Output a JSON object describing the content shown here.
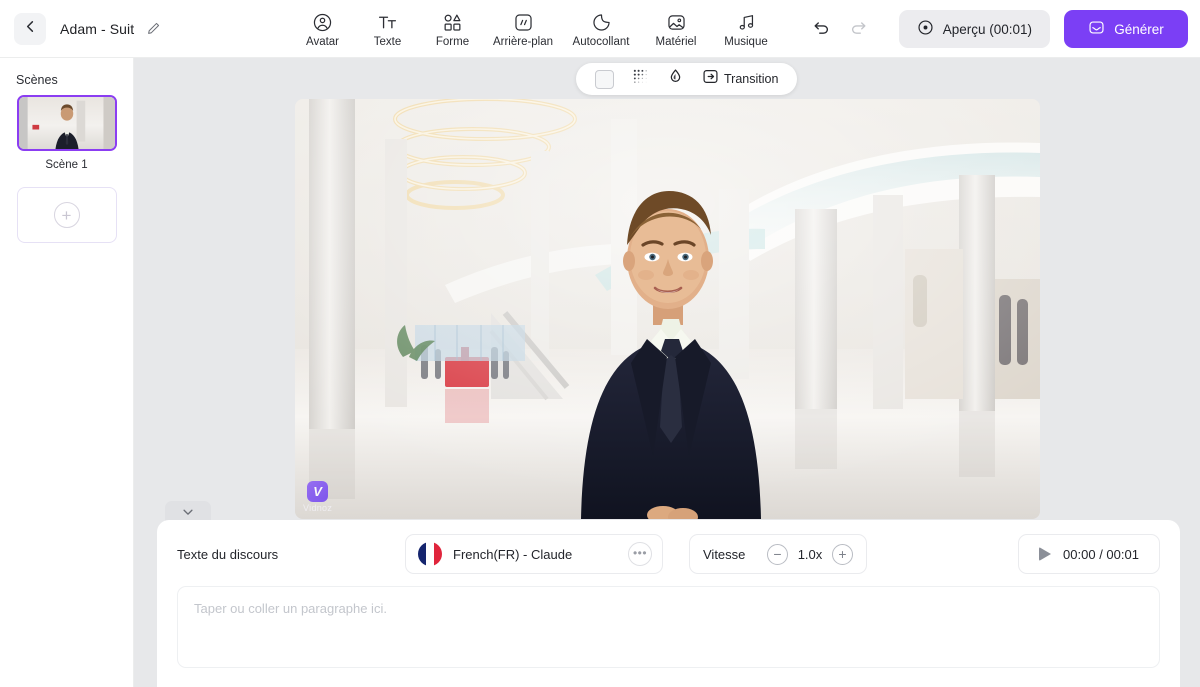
{
  "header": {
    "back_icon": "chevron-left-icon",
    "project_title": "Adam - Suit",
    "edit_icon": "pencil-edit-icon",
    "tools": [
      {
        "label": "Avatar",
        "icon": "avatar-person-circle-icon"
      },
      {
        "label": "Texte",
        "icon": "text-tt-icon"
      },
      {
        "label": "Forme",
        "icon": "shapes-grid-icon"
      },
      {
        "label": "Arrière-plan",
        "icon": "background-square-slash-icon"
      },
      {
        "label": "Autocollant",
        "icon": "sticker-circle-icon"
      },
      {
        "label": "Matériel",
        "icon": "image-media-icon"
      },
      {
        "label": "Musique",
        "icon": "music-notes-icon"
      }
    ],
    "undo": {
      "icon": "undo-arrow-icon",
      "enabled": true
    },
    "redo": {
      "icon": "redo-arrow-icon",
      "enabled": false
    },
    "preview_button": {
      "label": "Aperçu (00:01)",
      "icon": "play-circle-icon"
    },
    "generate_button": {
      "label": "Générer",
      "icon": "magic-generate-icon",
      "color": "#7b3ff5"
    }
  },
  "sidebar": {
    "title": "Scènes",
    "scenes": [
      {
        "label": "Scène 1",
        "selected": true,
        "border_color": "#8b3df2"
      }
    ],
    "add_scene": {
      "icon": "plus-circle-icon",
      "label": ""
    }
  },
  "stage": {
    "float_toolbar": [
      {
        "label": "",
        "icon": "color-swatch-icon"
      },
      {
        "label": "",
        "icon": "dither-pattern-icon"
      },
      {
        "label": "",
        "icon": "water-droplet-blur-icon"
      },
      {
        "label": "Transition",
        "icon": "transition-arrow-icon"
      }
    ],
    "watermark": {
      "logo": "vidnoz-v-logo",
      "text": "Vidnoz"
    },
    "collapse_handle": {
      "icon": "chevron-down-icon"
    }
  },
  "bottom": {
    "script_label": "Texte du discours",
    "voice": {
      "name": "French(FR) - Claude",
      "flag": "fr-flag-icon",
      "more_icon": "ellipsis-icon"
    },
    "speed": {
      "label": "Vitesse",
      "value": "1.0x",
      "minus_icon": "minus-circle-icon",
      "plus_icon": "plus-circle-icon"
    },
    "timecode": {
      "text": "00:00 / 00:01",
      "icon": "play-triangle-icon"
    },
    "script_placeholder": "Taper ou coller un paragraphe ici.",
    "script_value": ""
  }
}
